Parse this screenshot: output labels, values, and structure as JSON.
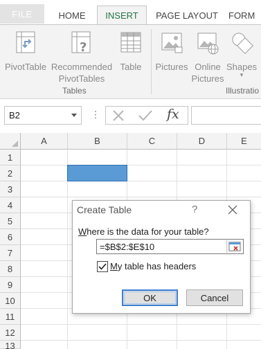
{
  "ribbon_tabs": [
    {
      "label": "FILE"
    },
    {
      "label": "HOME"
    },
    {
      "label": "INSERT"
    },
    {
      "label": "PAGE LAYOUT"
    },
    {
      "label": "FORM"
    }
  ],
  "active_tab": "INSERT",
  "ribbon": {
    "tables_group": {
      "buttons": [
        {
          "label": "PivotTable",
          "icon": "pivottable-icon"
        },
        {
          "label": "Recommended PivotTables",
          "icon": "recommended-pivottables-icon"
        },
        {
          "label": "Table",
          "icon": "table-icon"
        }
      ],
      "label": "Tables"
    },
    "illustrations_group": {
      "buttons": [
        {
          "label": "Pictures",
          "icon": "pictures-icon"
        },
        {
          "label": "Online Pictures",
          "icon": "online-pictures-icon"
        },
        {
          "label": "Shapes",
          "icon": "shapes-icon"
        }
      ],
      "label": "Illustratio"
    }
  },
  "formula_bar": {
    "name_box": "B2",
    "fx_label": "fx",
    "formula": ""
  },
  "grid": {
    "columns": [
      "A",
      "B",
      "C",
      "D",
      "E"
    ],
    "rows": [
      "1",
      "2",
      "3",
      "4",
      "5",
      "6",
      "7",
      "8",
      "9",
      "10",
      "11",
      "12",
      "13"
    ],
    "selected_cell": "B2"
  },
  "dialog": {
    "title": "Create Table",
    "help": "?",
    "prompt_prefix": "W",
    "prompt_rest": "here is the data for your table?",
    "range_value": "=$B$2:$E$10",
    "checkbox_checked": true,
    "checkbox_prefix": "M",
    "checkbox_rest": "y table has headers",
    "ok_label": "OK",
    "cancel_label": "Cancel"
  },
  "colors": {
    "accent_green": "#217346",
    "selection_blue": "#5b9bd5",
    "ok_border": "#3c7fd0"
  }
}
